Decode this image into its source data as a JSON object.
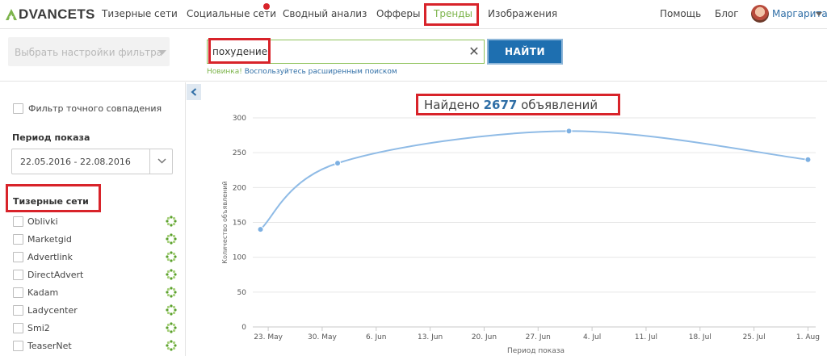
{
  "brand": {
    "logo_text": "DVANCETS",
    "logo_color": "#7cb44b"
  },
  "nav": {
    "items": [
      {
        "label": "Тизерные сети"
      },
      {
        "label": "Социальные сети",
        "has_notification": true
      },
      {
        "label": "Сводный анализ"
      },
      {
        "label": "Офферы"
      },
      {
        "label": "Тренды",
        "active": true
      },
      {
        "label": "Изображения"
      }
    ],
    "help": "Помощь",
    "blog": "Блог",
    "user_name": "Маргарита"
  },
  "filter": {
    "placeholder": "Выбрать настройки фильтра"
  },
  "search": {
    "value": "похудение",
    "clear_icon": "close-icon",
    "button_label": "НАЙТИ",
    "hint_new": "Новинка!",
    "hint_link": "Воспользуйтесь расширенным поиском"
  },
  "sidebar": {
    "exact_match_label": "Фильтр точного совпадения",
    "period_title": "Период показа",
    "period_value": "22.05.2016 - 22.08.2016",
    "networks_title": "Тизерные сети",
    "networks": [
      "Oblivki",
      "Marketgid",
      "Advertlink",
      "DirectAdvert",
      "Kadam",
      "Ladycenter",
      "Smi2",
      "TeaserNet"
    ]
  },
  "results": {
    "prefix": "Найдено",
    "count": "2677",
    "suffix": "объявлений"
  },
  "colors": {
    "accent_blue": "#1e6fb0",
    "accent_green": "#7cb44b",
    "highlight_red": "#d8232a",
    "line": "#8fbbe6"
  },
  "chart_data": {
    "type": "line",
    "title": "",
    "xlabel": "Период показа",
    "ylabel": "Количество объявлений",
    "ylim": [
      0,
      300
    ],
    "yticks": [
      0,
      50,
      100,
      150,
      200,
      250,
      300
    ],
    "xticks": [
      "23. May",
      "30. May",
      "6. Jun",
      "13. Jun",
      "20. Jun",
      "27. Jun",
      "4. Jul",
      "11. Jul",
      "18. Jul",
      "25. Jul",
      "1. Aug"
    ],
    "series": [
      {
        "x": [
          "2016-05-22",
          "2016-06-01",
          "2016-07-01",
          "2016-08-01"
        ],
        "y": [
          140,
          235,
          281,
          240
        ]
      }
    ],
    "grid": true,
    "legend": "none"
  }
}
